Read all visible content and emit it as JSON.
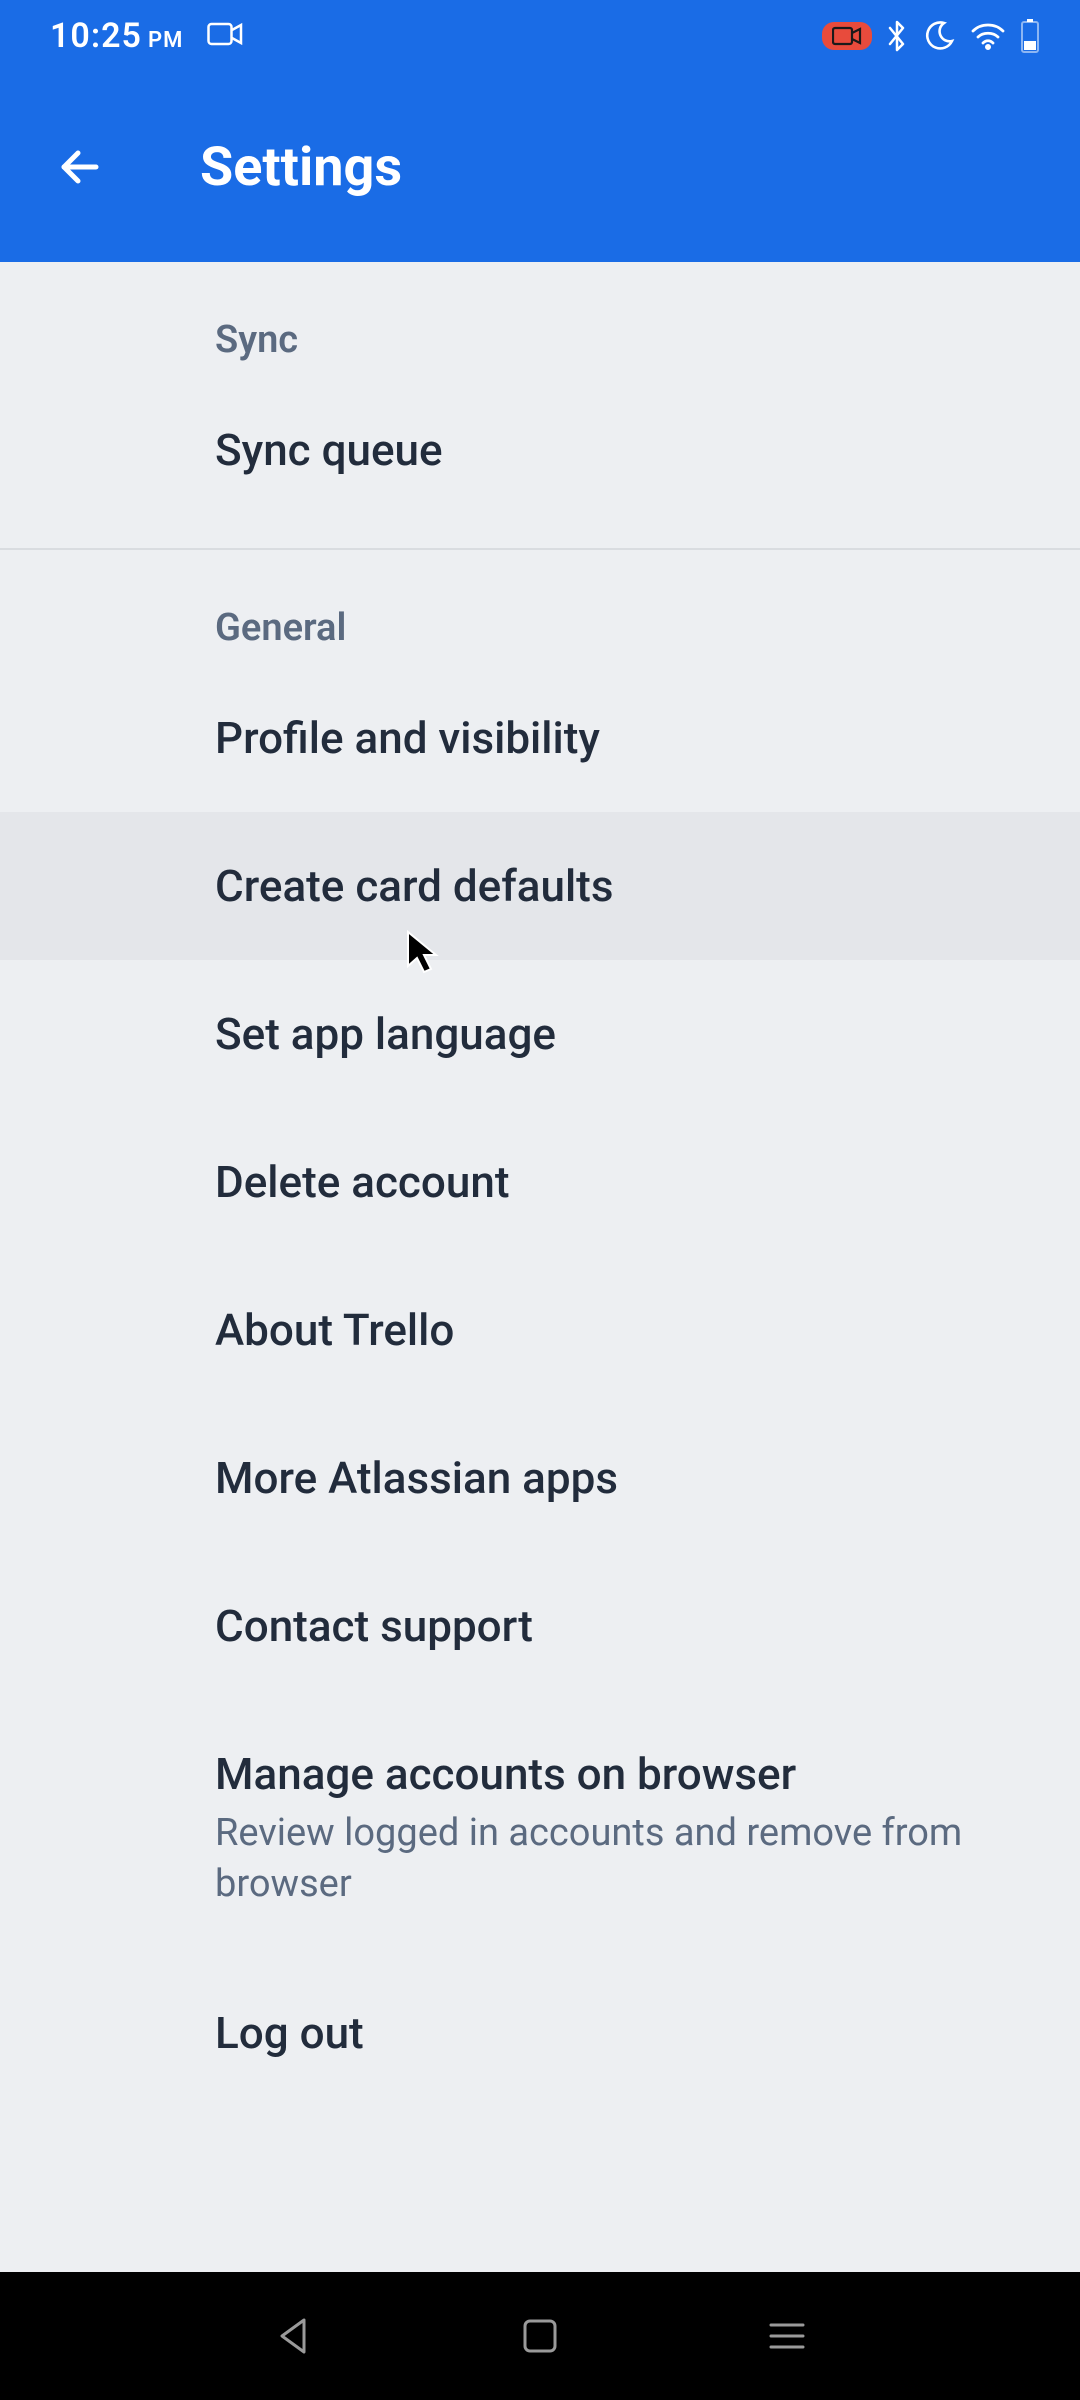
{
  "status": {
    "time": "10:25",
    "ampm": "PM"
  },
  "app_bar": {
    "title": "Settings"
  },
  "sections": [
    {
      "header": "Sync",
      "items": [
        {
          "label": "Sync queue"
        }
      ]
    },
    {
      "header": "General",
      "items": [
        {
          "label": "Profile and visibility"
        },
        {
          "label": "Create card defaults",
          "pressed": true
        },
        {
          "label": "Set app language"
        },
        {
          "label": "Delete account"
        },
        {
          "label": "About Trello"
        },
        {
          "label": "More Atlassian apps"
        },
        {
          "label": "Contact support"
        },
        {
          "label": "Manage accounts on browser",
          "sub": "Review logged in accounts and remove from browser"
        },
        {
          "label": "Log out"
        }
      ]
    }
  ]
}
